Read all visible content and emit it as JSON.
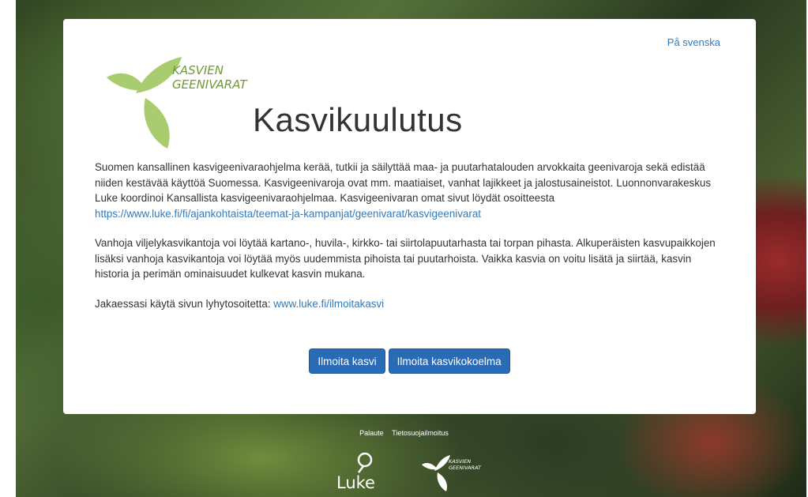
{
  "header": {
    "lang_link": "På svenska",
    "logo_text_line1": "KASVIEN",
    "logo_text_line2": "GEENIVARAT",
    "title": "Kasvikuulutus"
  },
  "content": {
    "paragraph1_text": "Suomen kansallinen kasvigeenivaraohjelma kerää, tutkii ja säilyttää maa- ja puutarhatalouden arvokkaita geenivaroja sekä edistää niiden kestävää käyttöä Suomessa. Kasvigeenivaroja ovat mm. maatiaiset, vanhat lajikkeet ja jalostusaineistot. Luonnonvarakeskus Luke koordinoi Kansallista kasvigeenivaraohjelmaa. Kasvigeenivaran omat sivut löydät osoitteesta ",
    "paragraph1_link": "https://www.luke.fi/fi/ajankohtaista/teemat-ja-kampanjat/geenivarat/kasvigeenivarat",
    "paragraph2_text": "Vanhoja viljelykasvikantoja voi löytää kartano-, huvila-, kirkko- tai siirtolapuutarhasta tai torpan pihasta. Alkuperäisten kasvupaikkojen lisäksi vanhoja kasvikantoja voi löytää myös uudemmista pihoista tai puutarhoista. Vaikka kasvia on voitu lisätä ja siirtää, kasvin historia ja perimän ominaisuudet kulkevat kasvin mukana.",
    "paragraph3_text": "Jakaessasi käytä sivun lyhytosoitetta: ",
    "paragraph3_link": "www.luke.fi/ilmoitakasvi"
  },
  "buttons": {
    "report_plant": "Ilmoita kasvi",
    "report_collection": "Ilmoita kasvikokoelma"
  },
  "footer": {
    "feedback_link": "Palaute",
    "privacy_link": "Tietosuojailmoitus",
    "luke_logo_text": "Luke",
    "kasvien_logo_line1": "KASVIEN",
    "kasvien_logo_line2": "GEENIVARAT"
  },
  "colors": {
    "link": "#337ab7",
    "button": "#2a6bb5",
    "logo_green": "#a9cc6f"
  }
}
